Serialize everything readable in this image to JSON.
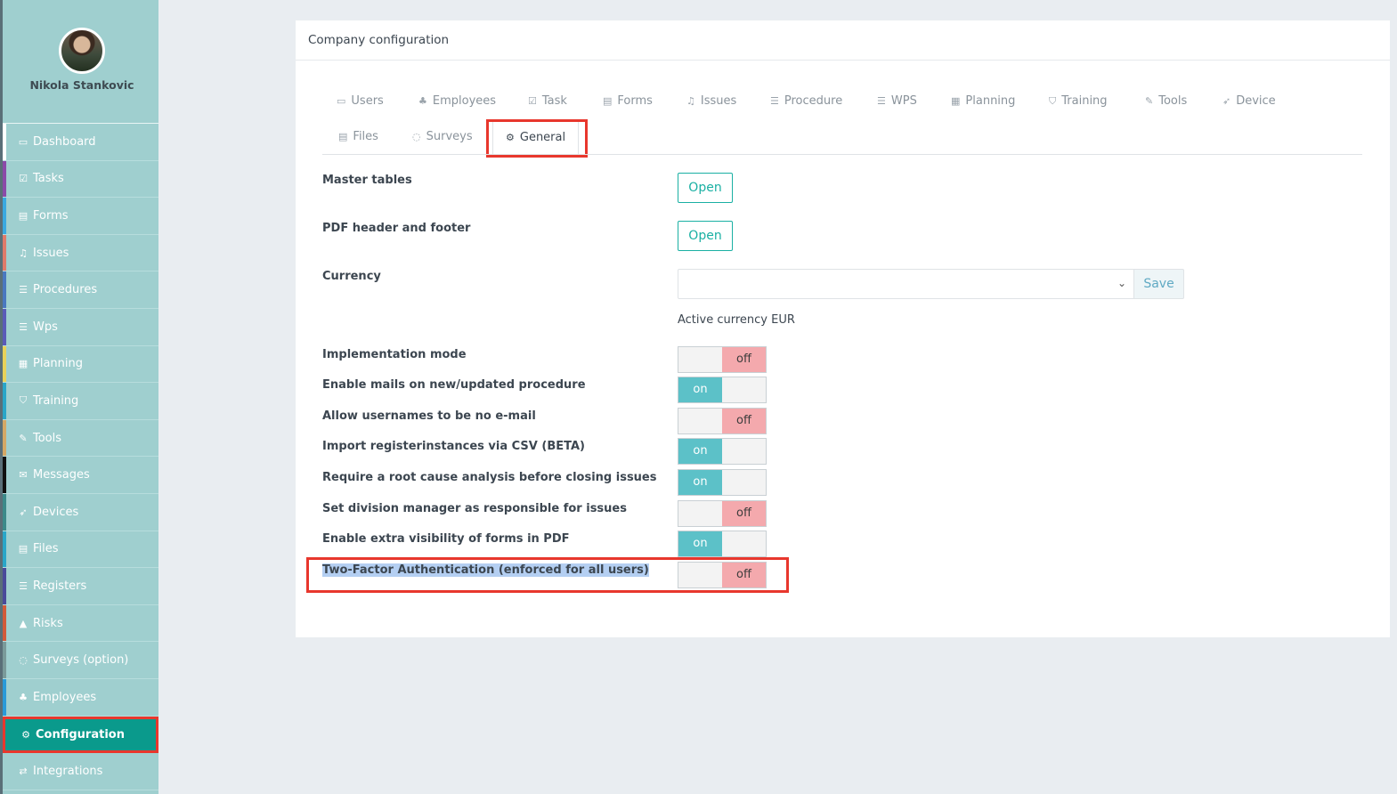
{
  "user": {
    "name": "Nikola Stankovic"
  },
  "sidebar": {
    "items": [
      {
        "label": "Dashboard",
        "icon": "monitor-icon",
        "glyph": "▭",
        "color": "#ffffff"
      },
      {
        "label": "Tasks",
        "icon": "check-square-icon",
        "glyph": "☑",
        "color": "#8b4aa8"
      },
      {
        "label": "Forms",
        "icon": "file-icon",
        "glyph": "▤",
        "color": "#3aa9e0"
      },
      {
        "label": "Issues",
        "icon": "bell-icon",
        "glyph": "♫",
        "color": "#e07a6a"
      },
      {
        "label": "Procedures",
        "icon": "list-icon",
        "glyph": "☰",
        "color": "#4a78c0"
      },
      {
        "label": "Wps",
        "icon": "list-icon",
        "glyph": "☰",
        "color": "#5b5bb8"
      },
      {
        "label": "Planning",
        "icon": "calendar-icon",
        "glyph": "▦",
        "color": "#e8d25a"
      },
      {
        "label": "Training",
        "icon": "graduation-cap-icon",
        "glyph": "⛉",
        "color": "#2aa6c8"
      },
      {
        "label": "Tools",
        "icon": "wrench-icon",
        "glyph": "✎",
        "color": "#d4a866"
      },
      {
        "label": "Messages",
        "icon": "envelope-icon",
        "glyph": "✉",
        "color": "#111111"
      },
      {
        "label": "Devices",
        "icon": "rocket-icon",
        "glyph": "➶",
        "color": "#3c8a8a"
      },
      {
        "label": "Files",
        "icon": "file-icon",
        "glyph": "▤",
        "color": "#2aa6c8"
      },
      {
        "label": "Registers",
        "icon": "list-icon",
        "glyph": "☰",
        "color": "#4a4a9a"
      },
      {
        "label": "Risks",
        "icon": "warning-icon",
        "glyph": "▲",
        "color": "#d25a3a"
      },
      {
        "label": "Surveys (option)",
        "icon": "comment-icon",
        "glyph": "◌",
        "color": "#7a9a9a"
      },
      {
        "label": "Employees",
        "icon": "users-icon",
        "glyph": "♣",
        "color": "#2a9ad8"
      },
      {
        "label": "Configuration",
        "icon": "gear-icon",
        "glyph": "⚙",
        "color": "#0a9a8c"
      },
      {
        "label": "Integrations",
        "icon": "exchange-icon",
        "glyph": "⇄",
        "color": "#9fcfcf"
      }
    ]
  },
  "card": {
    "title": "Company configuration"
  },
  "tabs": [
    {
      "label": "Users",
      "icon": "id-card-icon",
      "glyph": "▭"
    },
    {
      "label": "Employees",
      "icon": "users-icon",
      "glyph": "♣"
    },
    {
      "label": "Task",
      "icon": "check-square-icon",
      "glyph": "☑"
    },
    {
      "label": "Forms",
      "icon": "file-icon",
      "glyph": "▤"
    },
    {
      "label": "Issues",
      "icon": "bell-icon",
      "glyph": "♫"
    },
    {
      "label": "Procedure",
      "icon": "list-icon",
      "glyph": "☰"
    },
    {
      "label": "WPS",
      "icon": "list-icon",
      "glyph": "☰"
    },
    {
      "label": "Planning",
      "icon": "calendar-icon",
      "glyph": "▦"
    },
    {
      "label": "Training",
      "icon": "graduation-cap-icon",
      "glyph": "⛉"
    },
    {
      "label": "Tools",
      "icon": "wrench-icon",
      "glyph": "✎"
    },
    {
      "label": "Device",
      "icon": "rocket-icon",
      "glyph": "➶"
    },
    {
      "label": "Files",
      "icon": "file-icon",
      "glyph": "▤"
    },
    {
      "label": "Surveys",
      "icon": "comment-icon",
      "glyph": "◌"
    },
    {
      "label": "General",
      "icon": "gear-icon",
      "glyph": "⚙"
    }
  ],
  "active_tab": "General",
  "general": {
    "master_tables": {
      "label": "Master tables",
      "button": "Open"
    },
    "pdf_header_footer": {
      "label": "PDF header and footer",
      "button": "Open"
    },
    "currency": {
      "label": "Currency",
      "selected": "",
      "save": "Save",
      "active_text": "Active currency EUR"
    },
    "settings": [
      {
        "label": "Implementation mode",
        "state": "off",
        "text": "off"
      },
      {
        "label": "Enable mails on new/updated procedure",
        "state": "on",
        "text": "on"
      },
      {
        "label": "Allow usernames to be no e-mail",
        "state": "off",
        "text": "off"
      },
      {
        "label": "Import registerinstances via CSV (BETA)",
        "state": "on",
        "text": "on"
      },
      {
        "label": "Require a root cause analysis before closing issues",
        "state": "on",
        "text": "on"
      },
      {
        "label": "Set division manager as responsible for issues",
        "state": "off",
        "text": "off"
      },
      {
        "label": "Enable extra visibility of forms in PDF",
        "state": "on",
        "text": "on"
      },
      {
        "label": "Two-Factor Authentication (enforced for all users)",
        "state": "off",
        "text": "off"
      }
    ]
  },
  "colors": {
    "accent": "#1ab0a3",
    "sidebar": "#9fcfcf",
    "active_nav": "#0a9a8c",
    "highlight": "#e8372d",
    "toggle_on": "#5cc1c8",
    "toggle_off": "#f4a9ad"
  }
}
